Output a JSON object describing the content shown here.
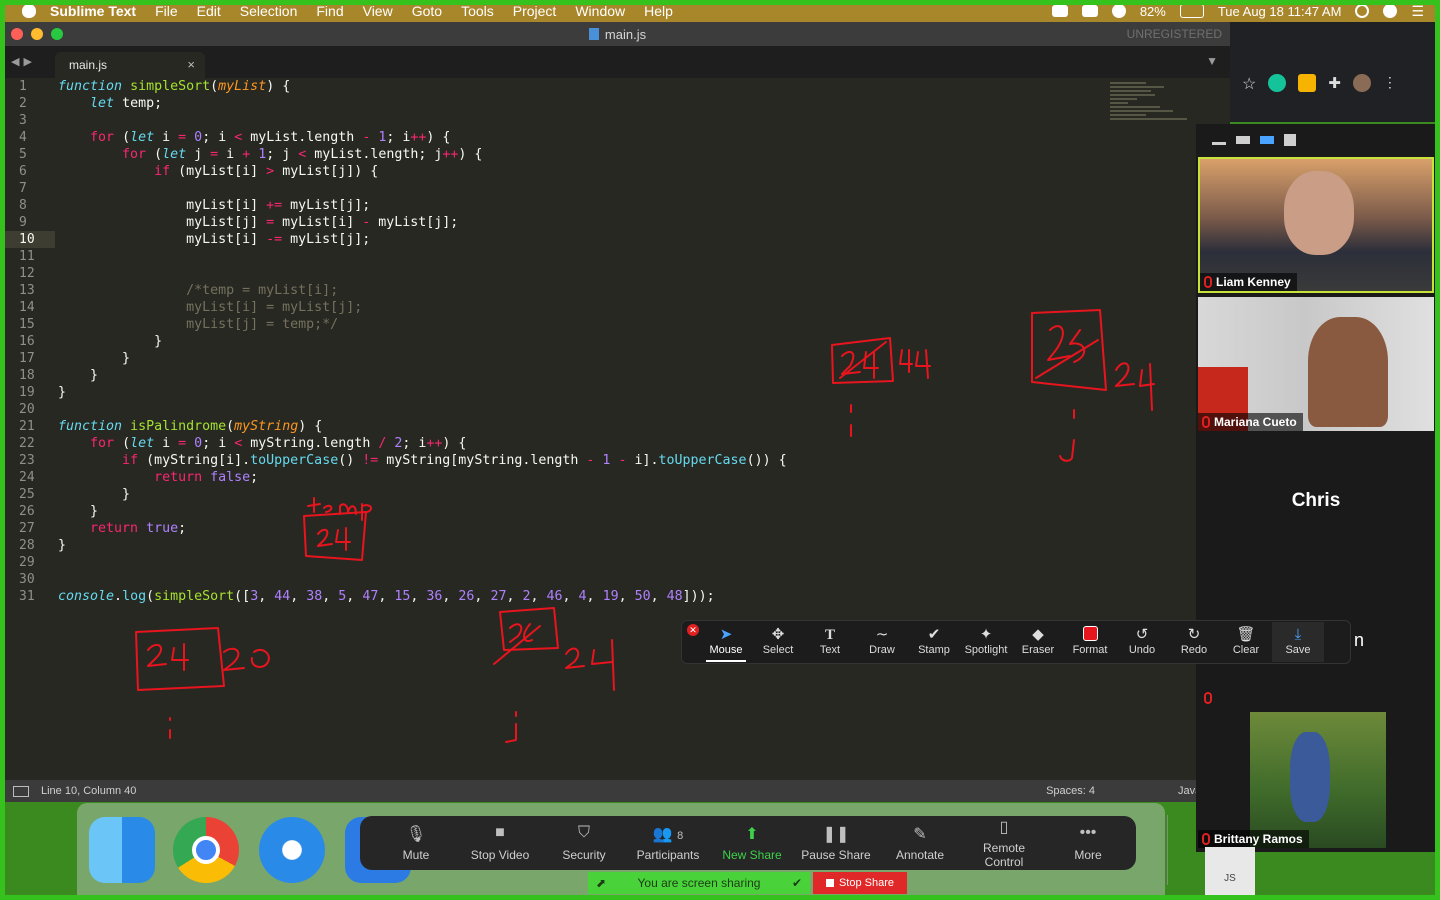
{
  "menubar": {
    "app": "Sublime Text",
    "items": [
      "File",
      "Edit",
      "Selection",
      "Find",
      "View",
      "Goto",
      "Tools",
      "Project",
      "Window",
      "Help"
    ],
    "battery": "82%",
    "datetime": "Tue Aug 18  11:47 AM"
  },
  "window": {
    "title": "main.js",
    "unregistered": "UNREGISTERED",
    "tab_label": "main.js",
    "tab_close": "×"
  },
  "editor": {
    "current_line": 10,
    "line_numbers": [
      "1",
      "2",
      "3",
      "4",
      "5",
      "6",
      "7",
      "8",
      "9",
      "10",
      "11",
      "12",
      "13",
      "14",
      "15",
      "16",
      "17",
      "18",
      "19",
      "20",
      "21",
      "22",
      "23",
      "24",
      "25",
      "26",
      "27",
      "28",
      "29",
      "30",
      "31"
    ]
  },
  "statusbar": {
    "position": "Line 10, Column 40",
    "spaces": "Spaces: 4",
    "syntax": "JavaScript"
  },
  "zoom_panel": {
    "participants": [
      {
        "name": "Liam Kenney"
      },
      {
        "name": "Mariana Cueto"
      },
      {
        "name": "Chris"
      },
      {
        "name": "Brittany Ramos"
      }
    ],
    "truncated_label": "n"
  },
  "annotate_toolbar": {
    "tools": [
      "Mouse",
      "Select",
      "Text",
      "Draw",
      "Stamp",
      "Spotlight",
      "Eraser",
      "Format",
      "Undo",
      "Redo",
      "Clear",
      "Save"
    ],
    "selected": "Mouse"
  },
  "share_bar": {
    "buttons": [
      "Mute",
      "Stop Video",
      "Security",
      "Participants",
      "New Share",
      "Pause Share",
      "Annotate",
      "Remote Control",
      "More"
    ],
    "participant_count": "8",
    "sharing_note": "You are screen sharing",
    "stop_share": "Stop Share"
  },
  "dock": {
    "js_label": "JS"
  },
  "colors": {
    "share_green": "#35c21c",
    "annotation_red": "#e8141e",
    "editor_bg": "#272822"
  }
}
